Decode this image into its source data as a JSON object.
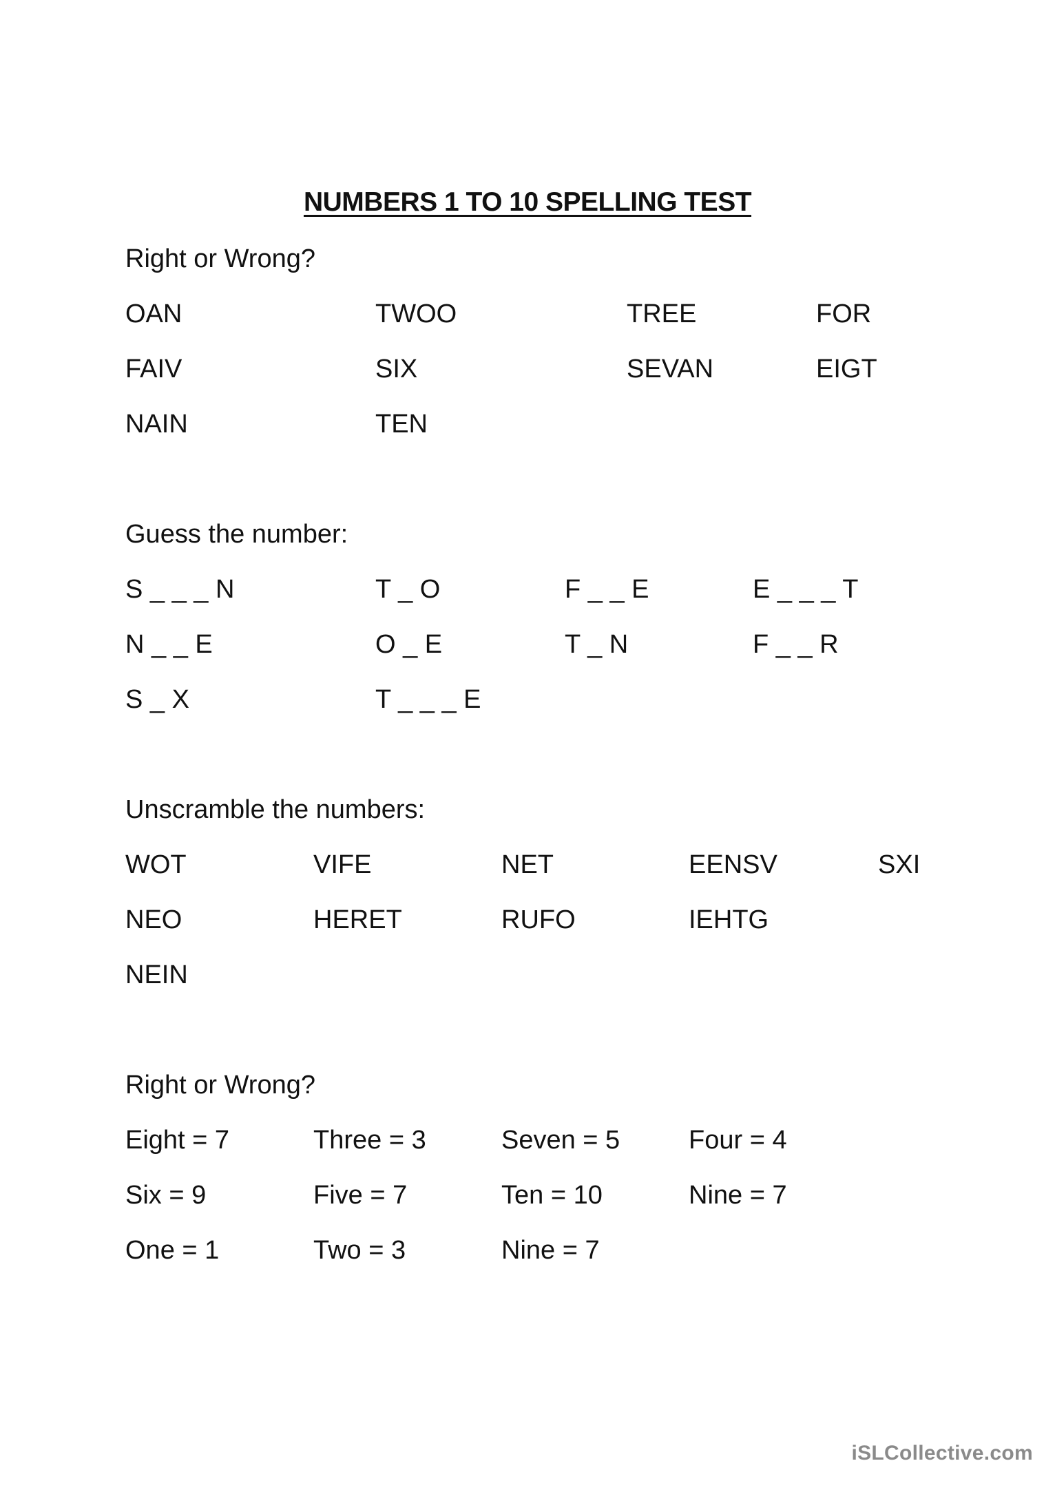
{
  "title": "NUMBERS 1 TO 10 SPELLING TEST",
  "sections": [
    {
      "heading": "Right or Wrong?",
      "rows": [
        [
          "OAN",
          "TWOO",
          "TREE",
          "FOR"
        ],
        [
          "FAIV",
          "SIX",
          "SEVAN",
          "EIGT"
        ],
        [
          "NAIN",
          "TEN"
        ]
      ]
    },
    {
      "heading": "Guess the number:",
      "rows": [
        [
          "S _ _ _ N",
          "T _ O",
          "F _ _ E",
          "E _ _ _ T"
        ],
        [
          "N _ _ E",
          "O _ E",
          "T _ N",
          "F _ _ R"
        ],
        [
          "S _ X",
          "T _ _ _ E"
        ]
      ]
    },
    {
      "heading": "Unscramble the numbers:",
      "rows": [
        [
          "WOT",
          "VIFE",
          "NET",
          "EENSV",
          "SXI"
        ],
        [
          "NEO",
          "HERET",
          "RUFO",
          "IEHTG"
        ],
        [
          "NEIN"
        ]
      ]
    },
    {
      "heading": "Right or Wrong?",
      "rows": [
        [
          "Eight = 7",
          "Three = 3",
          "Seven = 5",
          "Four = 4"
        ],
        [
          "Six = 9",
          "Five = 7",
          "Ten = 10",
          "Nine = 7"
        ],
        [
          "One = 1",
          "Two = 3",
          "Nine = 7"
        ]
      ]
    }
  ],
  "watermark": "iSLCollective.com"
}
